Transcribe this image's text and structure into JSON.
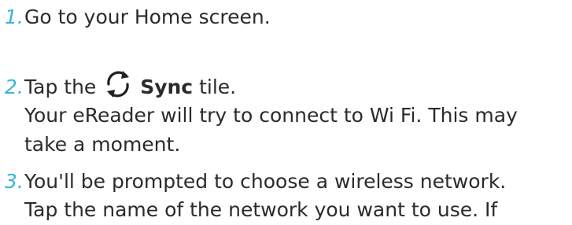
{
  "steps": [
    {
      "number": "1.",
      "lines": [
        "Go to your Home screen."
      ]
    },
    {
      "number": "2.",
      "prefix": "Tap the",
      "icon": "sync-icon",
      "bold": "Sync",
      "suffix": " tile.",
      "lines": [
        "Your eReader will try to connect to Wi Fi. This may",
        "take a moment."
      ]
    },
    {
      "number": "3.",
      "lines": [
        "You'll be prompted to choose a wireless network.",
        "Tap the name of the network you want to use. If"
      ]
    }
  ],
  "colors": {
    "number": "#39b3d6",
    "text": "#2b2b2b"
  }
}
